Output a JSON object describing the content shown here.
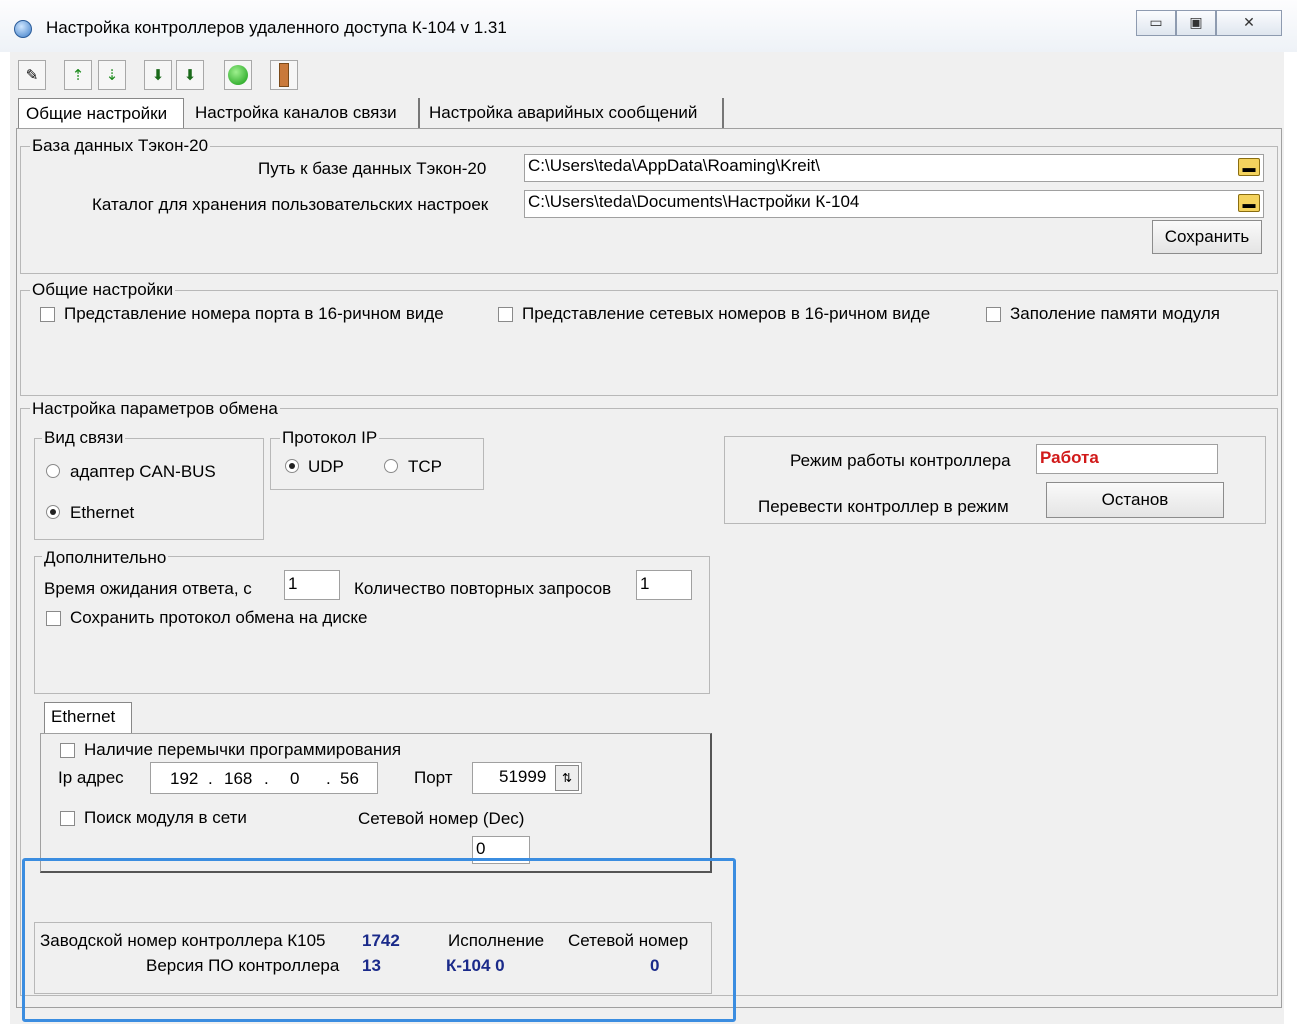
{
  "window": {
    "title": "Настройка контроллеров удаленного доступа К-104   v 1.31",
    "controls": {
      "minimize": "▭",
      "maximize": "▣",
      "close": "✕"
    }
  },
  "toolbar": {
    "icons": [
      "edit-icon",
      "add-icon",
      "download-icon",
      "import-icon",
      "export-icon",
      "connect-icon",
      "device-icon"
    ]
  },
  "tabs": [
    {
      "label": "Общие настройки"
    },
    {
      "label": "Настройка каналов связи"
    },
    {
      "label": "Настройка аварийных сообщений"
    }
  ],
  "database": {
    "legend": "База данных Тэкон-20",
    "path_label": "Путь к базе данных Тэкон-20",
    "path_value": "C:\\Users\\teda\\AppData\\Roaming\\Kreit\\",
    "catalog_label": "Каталог для хранения пользовательских настроек",
    "catalog_value": "C:\\Users\\teda\\Documents\\Настройки К-104",
    "save_label": "Сохранить"
  },
  "general": {
    "legend": "Общие настройки",
    "port_hex": "Представление номера порта в 16-ричном виде",
    "net_hex": "Представление сетевых номеров в 16-ричном виде",
    "fill_memory": "Заполение памяти модуля"
  },
  "exchange": {
    "legend": "Настройка параметров обмена",
    "link_type": {
      "legend": "Вид связи",
      "can": "адаптер CAN-BUS",
      "ethernet": "Ethernet",
      "selected": "Ethernet"
    },
    "protocol": {
      "legend": "Протокол IP",
      "udp": "UDP",
      "tcp": "TCP",
      "selected": "UDP"
    },
    "controller": {
      "mode_label": "Режим работы контроллера",
      "mode_value": "Работа",
      "mode_color": "#d11a1a",
      "switch_label": "Перевести  контроллер  в режим",
      "switch_button": "Останов"
    },
    "extra": {
      "legend": "Дополнительно",
      "timeout_label": "Время ожидания ответа, с",
      "timeout_value": "1",
      "retries_label": "Количество повторных запросов",
      "retries_value": "1",
      "save_log": "Сохранить протокол обмена на диске"
    },
    "ethernet": {
      "tab": "Ethernet",
      "jumper": "Наличие перемычки программирования",
      "ip_label": "Ip адрес",
      "ip": [
        "192",
        "168",
        "0",
        "56"
      ],
      "port_label": "Порт",
      "port_value": "51999",
      "search": "Поиск модуля в сети",
      "netnum_label": "Сетевой номер (Dec)",
      "netnum_value": "0"
    }
  },
  "info": {
    "serial_label": "Заводской номер контроллера К105",
    "serial_value": "1742",
    "version_label": "Версия ПО контроллера",
    "version_value": "13",
    "exec_label": "Исполнение",
    "exec_value": "К-104 0",
    "net_label": "Сетевой номер",
    "net_value": "0",
    "value_color": "#1a2a8a",
    "highlight_color": "#3b8de0"
  }
}
